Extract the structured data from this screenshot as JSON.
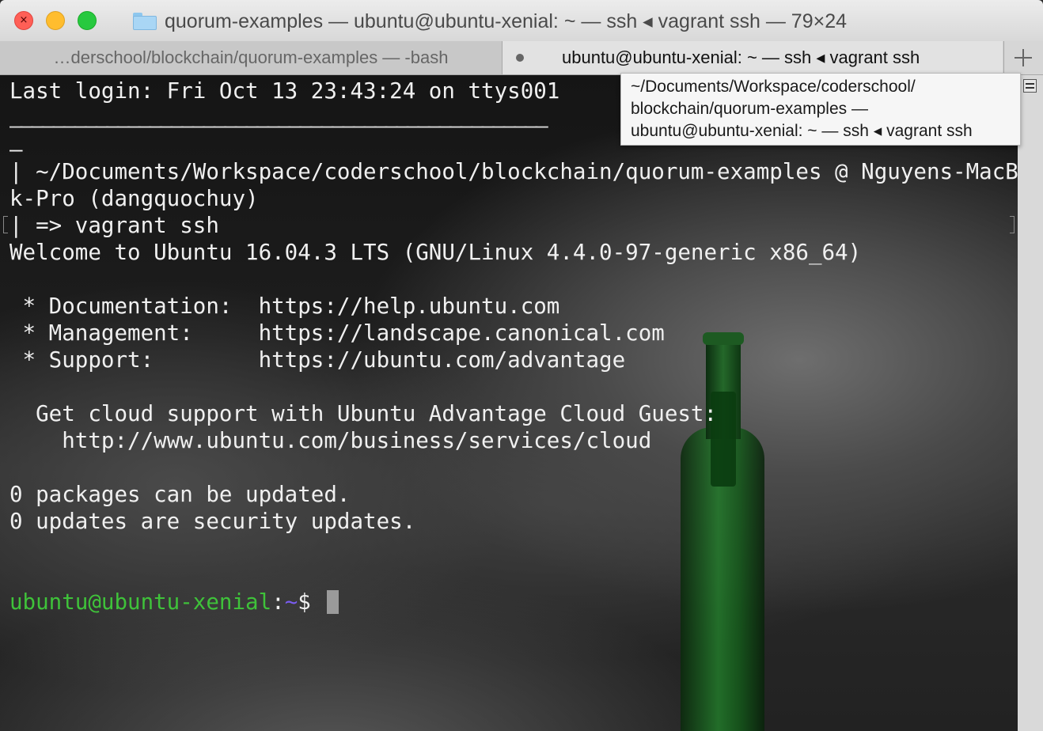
{
  "window": {
    "title": "quorum-examples — ubuntu@ubuntu-xenial: ~ — ssh ◂ vagrant ssh — 79×24",
    "folder_icon": "folder-icon"
  },
  "tabs": [
    {
      "label": "…derschool/blockchain/quorum-examples — -bash"
    },
    {
      "label": "ubuntu@ubuntu-xenial: ~ — ssh ◂ vagrant ssh"
    }
  ],
  "tooltip": {
    "line1": "~/Documents/Workspace/coderschool/",
    "line2": "blockchain/quorum-examples —",
    "line3": "ubuntu@ubuntu-xenial: ~ — ssh ◂ vagrant ssh"
  },
  "terminal": {
    "lines": [
      "Last login: Fri Oct 13 23:43:24 on ttys001",
      "——————————————————————————————————————————————————",
      "—",
      "| ~/Documents/Workspace/coderschool/blockchain/quorum-examples @ Nguyens-MacBoo",
      "k-Pro (dangquochuy)",
      "| => vagrant ssh",
      "Welcome to Ubuntu 16.04.3 LTS (GNU/Linux 4.4.0-97-generic x86_64)",
      "",
      " * Documentation:  https://help.ubuntu.com",
      " * Management:     https://landscape.canonical.com",
      " * Support:        https://ubuntu.com/advantage",
      "",
      "  Get cloud support with Ubuntu Advantage Cloud Guest:",
      "    http://www.ubuntu.com/business/services/cloud",
      "",
      "0 packages can be updated.",
      "0 updates are security updates.",
      "",
      ""
    ],
    "prompt": {
      "user_host": "ubuntu@ubuntu-xenial",
      "separator": ":",
      "path": "~",
      "symbol": "$"
    }
  },
  "colors": {
    "prompt_user": "#3fc23a",
    "prompt_path": "#7a5cf0",
    "terminal_text": "#f0f0f0"
  }
}
